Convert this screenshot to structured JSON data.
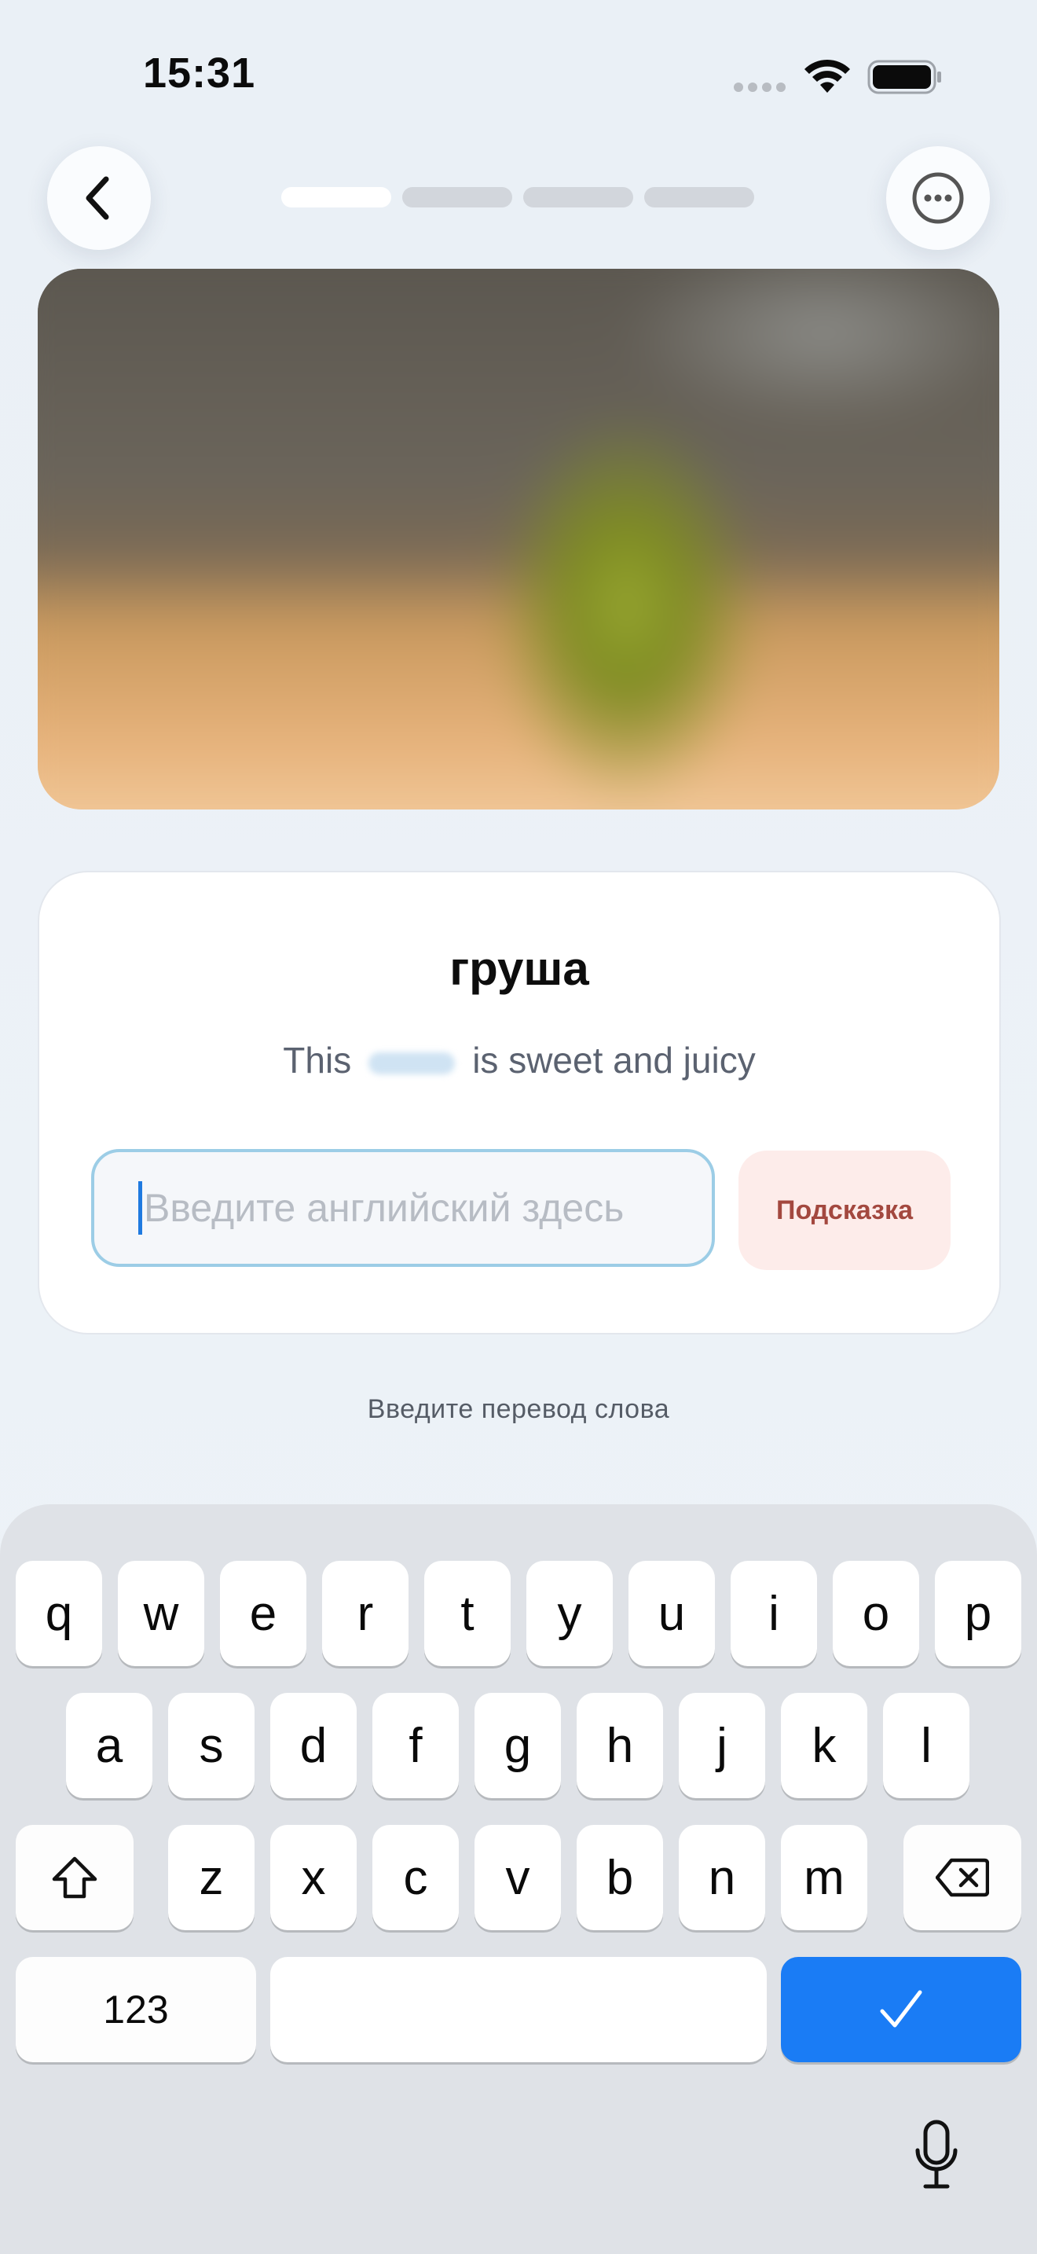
{
  "status_bar": {
    "time": "15:31"
  },
  "progress": {
    "current_step": 1,
    "total_steps": 4
  },
  "exercise": {
    "word": "груша",
    "sentence_before": "This",
    "sentence_after": "is sweet and juicy",
    "input_placeholder": "Введите английский здесь",
    "hint_label": "Подсказка",
    "instruction": "Введите перевод слова"
  },
  "keyboard": {
    "row1": [
      "q",
      "w",
      "e",
      "r",
      "t",
      "y",
      "u",
      "i",
      "o",
      "p"
    ],
    "row2": [
      "a",
      "s",
      "d",
      "f",
      "g",
      "h",
      "j",
      "k",
      "l"
    ],
    "row3": [
      "z",
      "x",
      "c",
      "v",
      "b",
      "n",
      "m"
    ],
    "numbers_label": "123"
  },
  "icons": {
    "back": "chevron-left-icon",
    "more": "ellipsis-circle-icon",
    "shift": "shift-icon",
    "delete": "delete-icon",
    "return": "checkmark-icon",
    "mic": "microphone-icon"
  },
  "colors": {
    "accent_blue": "#1a7cf5",
    "hint_bg": "#fdecea",
    "hint_text": "#a3483f",
    "input_border": "#9ccde6"
  }
}
